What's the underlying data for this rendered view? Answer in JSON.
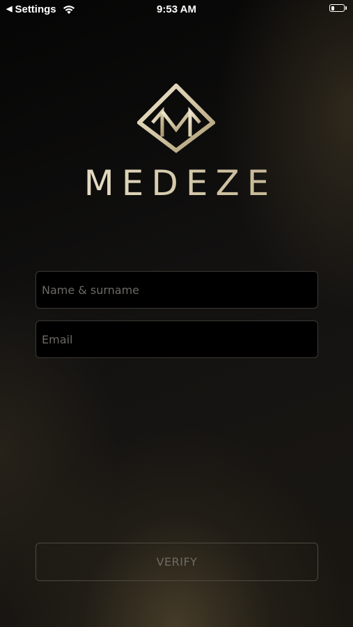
{
  "status_bar": {
    "back_label": "Settings",
    "time": "9:53 AM",
    "battery_level": 0.25,
    "icons": [
      "back-arrow-icon",
      "wifi-icon",
      "battery-icon"
    ]
  },
  "brand": {
    "name": "MEDEZE",
    "logo": "medeze-diamond-m-logo",
    "accent_color_light": "#f2ebd9",
    "accent_color_dark": "#b8a983"
  },
  "form": {
    "name_placeholder": "Name & surname",
    "name_value": "",
    "email_placeholder": "Email",
    "email_value": ""
  },
  "actions": {
    "verify_label": "VERIFY"
  },
  "colors": {
    "background": "#121110",
    "field_background": "#000000",
    "field_border": "#3c3a36",
    "placeholder": "#6c6a66",
    "button_border": "#4e4a40",
    "button_text": "#6f6b63"
  }
}
